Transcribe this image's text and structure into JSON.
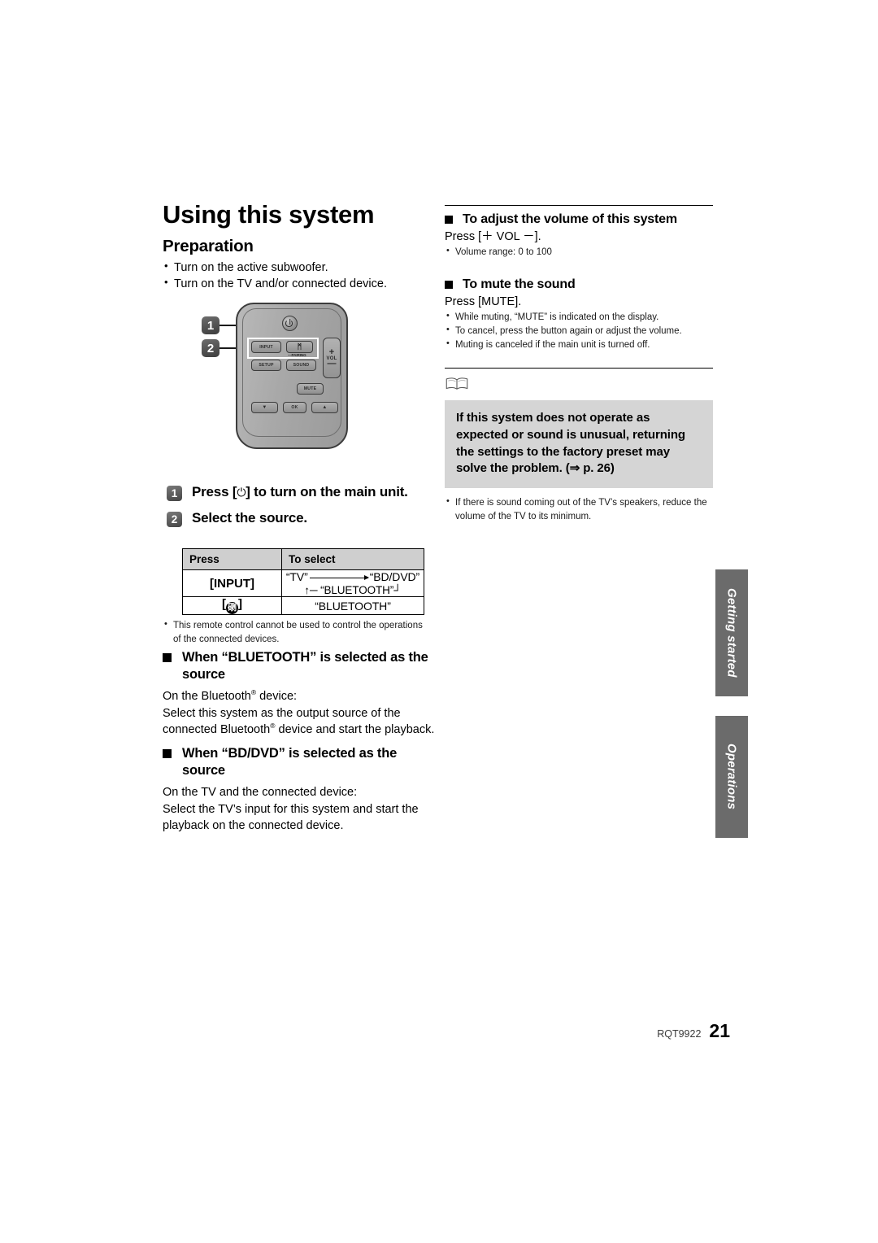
{
  "document": {
    "footer_code": "RQT9922",
    "page_number": "21"
  },
  "left_column": {
    "title": "Using this system",
    "preparation_heading": "Preparation",
    "preparation_items": [
      "Turn on the active subwoofer.",
      "Turn on the TV and/or connected device."
    ],
    "steps": [
      {
        "number": "1",
        "text_before": "Press [",
        "power_glyph": "⏻",
        "text_after": "] to turn on the main unit."
      },
      {
        "number": "2",
        "text": "Select the source."
      }
    ],
    "table": {
      "headers": [
        "Press",
        "To select"
      ],
      "rows": [
        {
          "press": "[INPUT]",
          "select_from": "“TV”",
          "select_to": "“BD/DVD”",
          "select_loop": "“BLUETOOTH”"
        },
        {
          "press_bracket_open": "[",
          "press_icon": "bluetooth-icon",
          "press_bracket_close": "]",
          "select": "“BLUETOOTH”"
        }
      ]
    },
    "table_note": "This remote control cannot be used to control the operations of the connected devices.",
    "bluetooth_section": {
      "heading": "When “BLUETOOTH” is selected as the source",
      "line1_pre": "On the Bluetooth",
      "line1_post": " device:",
      "line2_pre": "Select this system as the output source of the connected Bluetooth",
      "line2_post": " device and start the playback."
    },
    "bddvd_section": {
      "heading": "When “BD/DVD” is selected as the source",
      "line1": "On the TV and the connected device:",
      "line2": "Select the TV’s input for this system and start the playback on the connected device."
    }
  },
  "remote": {
    "power_label": "power-button",
    "buttons": {
      "input": "INPUT",
      "bluetooth_glyph": "ᛗ",
      "pairing": "—PAIRING",
      "setup": "SETUP",
      "sound": "SOUND",
      "mute": "MUTE",
      "ok": "OK",
      "down": "▼",
      "up": "▲"
    },
    "volume": {
      "plus": "+",
      "label": "VOL",
      "minus": "—"
    },
    "callouts": [
      "1",
      "2"
    ]
  },
  "right_column": {
    "volume_section": {
      "heading": "To adjust the volume of this system",
      "instruction": "Press [＋ VOL －].",
      "notes": [
        "Volume range: 0 to 100"
      ]
    },
    "mute_section": {
      "heading": "To mute the sound",
      "instruction": "Press [MUTE].",
      "notes": [
        "While muting, “MUTE” is indicated on the display.",
        "To cancel, press the button again or adjust the volume.",
        "Muting is canceled if the main unit is turned off."
      ]
    },
    "note_block": {
      "icon": "book-icon",
      "text": "If this system does not operate as expected or sound is unusual, returning the settings to the factory preset may solve the problem. (⇒ p. 26)",
      "after_notes": [
        "If there is sound coming out of the TV’s speakers, reduce the volume of the TV to its minimum."
      ]
    }
  },
  "side_tabs": [
    {
      "label": "Getting started"
    },
    {
      "label": "Operations"
    }
  ],
  "colors": {
    "note_box_bg": "#d5d5d5",
    "table_header_bg": "#cfcfcf",
    "side_tab_bg": "#6b6b6b"
  }
}
